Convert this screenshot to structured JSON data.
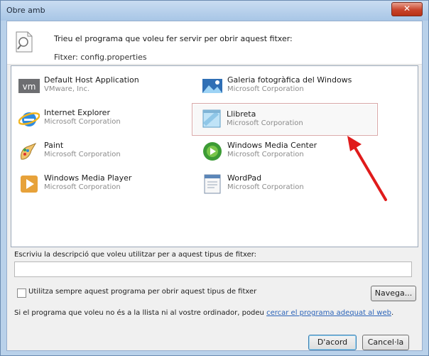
{
  "window": {
    "title": "Obre amb",
    "close_glyph": "✕"
  },
  "header": {
    "instruction": "Trieu el programa que voleu fer servir per obrir aquest fitxer:",
    "file_label": "Fitxer: config.properties"
  },
  "programs": [
    {
      "name": "Default Host Application",
      "publisher": "VMware, Inc.",
      "icon": "vmware-icon"
    },
    {
      "name": "Galeria fotogràfica del Windows",
      "publisher": "Microsoft Corporation",
      "icon": "photo-gallery-icon"
    },
    {
      "name": "Internet Explorer",
      "publisher": "Microsoft Corporation",
      "icon": "internet-explorer-icon"
    },
    {
      "name": "Llibreta",
      "publisher": "Microsoft Corporation",
      "icon": "notepad-icon",
      "selected": true
    },
    {
      "name": "Paint",
      "publisher": "Microsoft Corporation",
      "icon": "paint-icon"
    },
    {
      "name": "Windows Media Center",
      "publisher": "Microsoft Corporation",
      "icon": "media-center-icon"
    },
    {
      "name": "Windows Media Player",
      "publisher": "Microsoft Corporation",
      "icon": "media-player-icon"
    },
    {
      "name": "WordPad",
      "publisher": "Microsoft Corporation",
      "icon": "wordpad-icon"
    }
  ],
  "description": {
    "label": "Escriviu la descripció que voleu utilitzar per a aquest tipus de fitxer:",
    "value": ""
  },
  "always_use": {
    "label": "Utilitza sempre aquest programa per obrir aquest tipus de fitxer",
    "checked": false
  },
  "browse_label": "Navega...",
  "hint": {
    "prefix": "Si el programa que voleu no és a la llista ni al vostre ordinador, podeu ",
    "link": "cercar el programa adequat al web",
    "suffix": "."
  },
  "buttons": {
    "ok": "D'acord",
    "cancel": "Cancel·la"
  },
  "colors": {
    "accent": "#2b63b8",
    "annotation_arrow": "#e01b1b",
    "selection_border": "#d8a8a8"
  }
}
